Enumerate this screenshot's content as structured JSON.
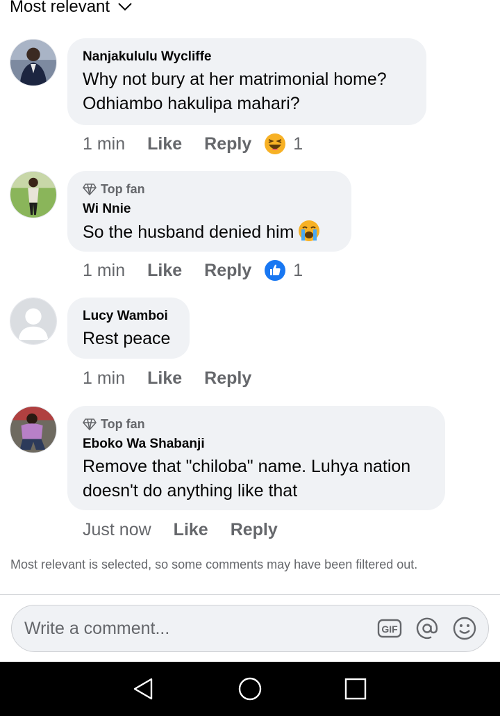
{
  "sort": {
    "label": "Most relevant"
  },
  "comments": [
    {
      "author": "Nanjakululu Wycliffe",
      "text": "Why not bury at her matrimonial home?\nOdhiambo hakulipa mahari?",
      "time": "1 min",
      "like": "Like",
      "reply": "Reply",
      "reaction": {
        "icon": "laughing-emoji-icon",
        "count": "1"
      }
    },
    {
      "badge": "Top fan",
      "author": "Wi Nnie",
      "text": "So the husband denied him",
      "text_emoji": "crying-emoji-icon",
      "time": "1 min",
      "like": "Like",
      "reply": "Reply",
      "reaction": {
        "icon": "thumbs-up-reaction-icon",
        "count": "1"
      }
    },
    {
      "author": "Lucy Wamboi",
      "text": "Rest peace",
      "time": "1 min",
      "like": "Like",
      "reply": "Reply"
    },
    {
      "badge": "Top fan",
      "author": "Eboko Wa Shabanji",
      "text": "Remove that \"chiloba\" name. Luhya nation\ndoesn't do anything like that",
      "time": "Just now",
      "like": "Like",
      "reply": "Reply"
    }
  ],
  "filter_note": "Most relevant is selected, so some comments may have been filtered out.",
  "composer": {
    "placeholder": "Write a comment...",
    "tools": [
      "gif-icon",
      "at-mention-icon",
      "emoji-icon"
    ]
  },
  "navbar": {
    "buttons": [
      "back-icon",
      "home-icon",
      "recents-icon"
    ]
  },
  "colors": {
    "bubble": "#f0f2f5",
    "secondary_text": "#65676b",
    "like_blue": "#1877f2",
    "emoji_yellow": "#f7b125"
  }
}
